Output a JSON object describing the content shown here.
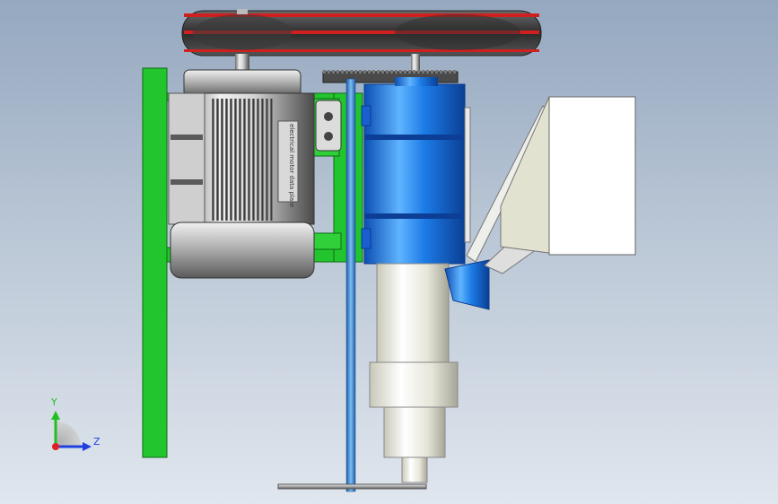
{
  "viewport": {
    "background_top": "#95a8c0",
    "background_bottom": "#e0e6ee"
  },
  "colors": {
    "frame": "#22c52e",
    "cylinder": "#1a76e0",
    "belt_stripe": "#d01f1f",
    "shaft": "#3e8fd8",
    "motor_body": "#b8b8b8",
    "housing": "#f1f1e8"
  },
  "triad": {
    "y_label": "Y",
    "z_label": "Z",
    "x_color": "#e02020",
    "y_color": "#20c020",
    "z_color": "#2040e0"
  },
  "motor_plate_text": "electrical motor data plate"
}
